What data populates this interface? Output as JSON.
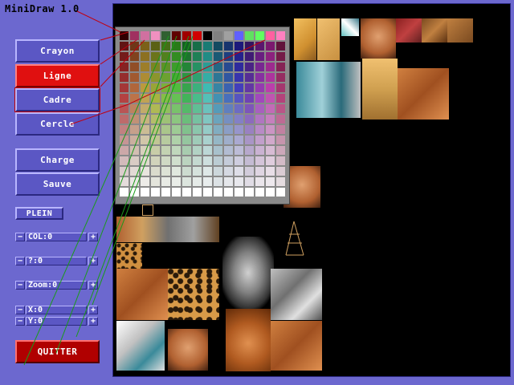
{
  "app": {
    "title": "MiniDraw 1.0"
  },
  "tools": {
    "crayon": "Crayon",
    "ligne": "Ligne",
    "cadre": "Cadre",
    "cercle": "Cercle",
    "active": "ligne"
  },
  "file": {
    "charge": "Charge",
    "sauve": "Sauve"
  },
  "fill": {
    "plein": "PLEIN"
  },
  "params": {
    "col": "COL:0",
    "q": "?:0",
    "zoom": "Zoom:0",
    "x": "X:0",
    "y": "Y:0",
    "minus": "−",
    "plus": "+"
  },
  "quit": {
    "label": "QUITTER"
  },
  "colors": {
    "panel": "#6c68cf",
    "button": "#5b57c4",
    "active": "#e01010",
    "quit": "#b00000",
    "line_green": "#1a9a1a",
    "line_red": "#c00010"
  },
  "palette": {
    "rows": 16,
    "cols": 16,
    "top_row": [
      "#300000",
      "#a03060",
      "#d070a0",
      "#f090c0",
      "#306030",
      "#600000",
      "#a00000",
      "#d00000",
      "#000000",
      "#808080",
      "#a0a0a0",
      "#6060ff",
      "#60e060",
      "#60ff60",
      "#ff60a0",
      "#ff80c0",
      "#ffff00",
      "#ffffff"
    ]
  },
  "canvas_content": {
    "description_icons": [
      "face-texture",
      "gorilla-texture",
      "leopard-texture",
      "wood-texture",
      "rock-texture",
      "bear-texture",
      "machine-sprite"
    ]
  }
}
